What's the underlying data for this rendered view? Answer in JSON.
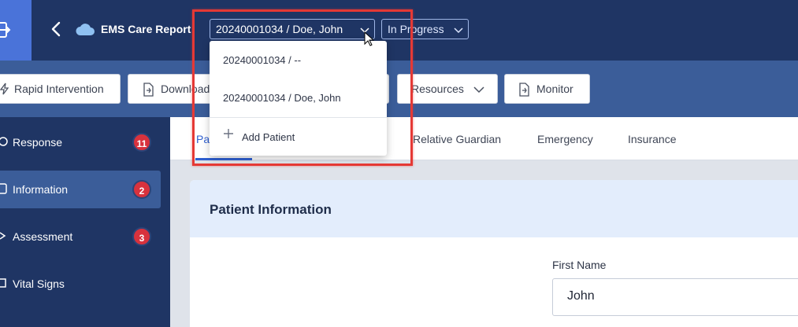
{
  "header": {
    "app_title": "EMS Care Report",
    "patient_selector_value": "20240001034 / Doe, John",
    "status_value": "In Progress"
  },
  "toolbar": {
    "buttons": [
      {
        "label": "Rapid Intervention",
        "icon": "lightning-icon"
      },
      {
        "label": "Download",
        "icon": "document-icon"
      },
      {
        "label": "Resources",
        "icon": "chevron-down-icon"
      },
      {
        "label": "Monitor",
        "icon": "document-icon"
      }
    ]
  },
  "sidebar": {
    "items": [
      {
        "label": "Response",
        "badge": "11",
        "icon": "response-icon"
      },
      {
        "label": "Information",
        "badge": "2",
        "icon": "info-icon",
        "active": true
      },
      {
        "label": "Assessment",
        "badge": "3",
        "icon": "assessment-icon"
      },
      {
        "label": "Vital Signs",
        "badge": "",
        "icon": "vitals-icon"
      }
    ]
  },
  "tabs": {
    "items": [
      "Pa",
      "Relative Guardian",
      "Emergency",
      "Insurance"
    ]
  },
  "card": {
    "title": "Patient Information",
    "first_name_label": "First Name",
    "first_name_value": "John"
  },
  "dropdown": {
    "options": [
      "20240001034 / --",
      "20240001034 / Doe, John"
    ],
    "add_label": "Add Patient"
  },
  "colors": {
    "topbar": "#1f3564",
    "toolbar": "#3b5d99",
    "accent": "#2f5fd0",
    "badge": "#d8323d",
    "highlight": "#e53935"
  }
}
